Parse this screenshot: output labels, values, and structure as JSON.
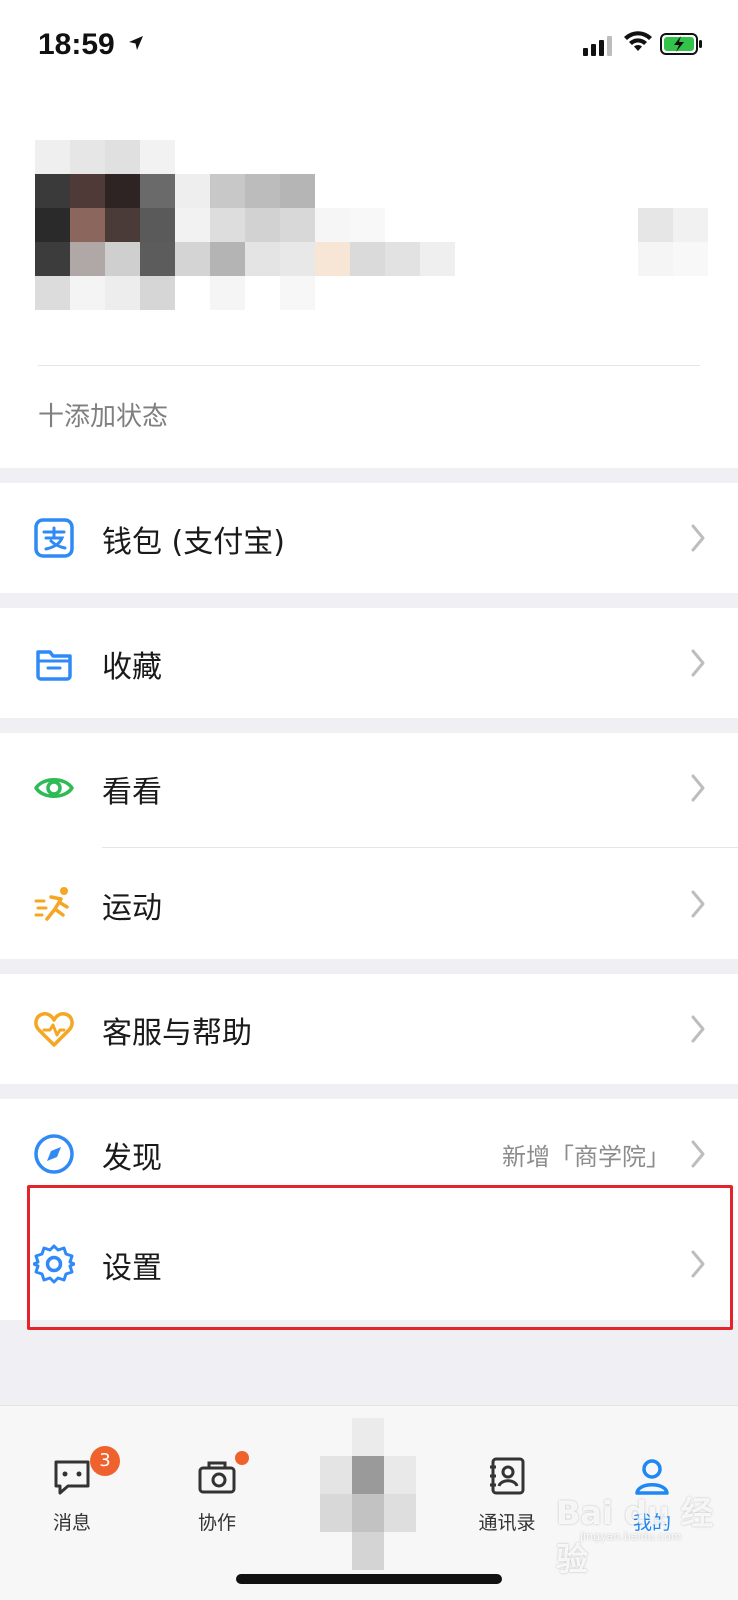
{
  "status_bar": {
    "time": "18:59",
    "icons": [
      "location-arrow-icon",
      "signal-icon",
      "wifi-icon",
      "battery-charging-icon"
    ]
  },
  "profile": {
    "add_status": "十添加状态",
    "avatar_note": "pixelated"
  },
  "menu": {
    "wallet": {
      "label": "钱包 (支付宝)",
      "icon": "alipay-icon",
      "color": "#2f8af5"
    },
    "favorites": {
      "label": "收藏",
      "icon": "folder-icon",
      "color": "#2f8af5"
    },
    "look": {
      "label": "看看",
      "icon": "eye-icon",
      "color": "#2dbb55"
    },
    "sports": {
      "label": "运动",
      "icon": "running-icon",
      "color": "#f5a623"
    },
    "help": {
      "label": "客服与帮助",
      "icon": "heart-icon",
      "color": "#f5a623"
    },
    "discover": {
      "label": "发现",
      "sub": "新增「商学院」",
      "icon": "compass-icon",
      "color": "#2f8af5"
    },
    "settings": {
      "label": "设置",
      "icon": "gear-icon",
      "color": "#2f8af5"
    }
  },
  "tabbar": {
    "messages": {
      "label": "消息",
      "badge": "3"
    },
    "collab": {
      "label": "协作"
    },
    "contacts": {
      "label": "通讯录"
    },
    "me": {
      "label": "我的",
      "active": true
    }
  },
  "watermark": {
    "main": "Bai du 经验",
    "sub": "jingyan.baidu.com"
  },
  "colors": {
    "accent": "#1e88f5",
    "highlight_border": "#e3242b",
    "badge": "#f0622d"
  }
}
